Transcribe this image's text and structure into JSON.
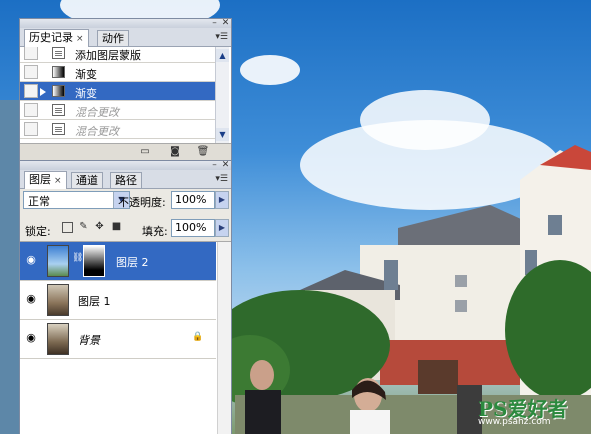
{
  "history_panel": {
    "tabs": [
      {
        "label": "历史记录",
        "close": "×"
      },
      {
        "label": "动作"
      }
    ],
    "menu_icon": "▾☰",
    "items": [
      {
        "label": "添加图层蒙版",
        "icon": "document-icon",
        "state": "normal"
      },
      {
        "label": "渐变",
        "icon": "gradient-icon",
        "state": "normal"
      },
      {
        "label": "渐变",
        "icon": "gradient-icon",
        "state": "selected"
      },
      {
        "label": "混合更改",
        "icon": "document-icon",
        "state": "greyed"
      },
      {
        "label": "混合更改",
        "icon": "document-icon",
        "state": "greyed"
      }
    ],
    "bottom_buttons": [
      "new-document-from-state-icon",
      "new-snapshot-icon",
      "trash-icon"
    ]
  },
  "layers_panel": {
    "tabs": [
      {
        "label": "图层",
        "close": "×"
      },
      {
        "label": "通道"
      },
      {
        "label": "路径"
      }
    ],
    "blend_mode": "正常",
    "opacity_label": "不透明度:",
    "opacity_value": "100%",
    "lock_label": "锁定:",
    "lock_icons": [
      "lock-transparent-icon",
      "lock-image-icon",
      "lock-position-icon",
      "lock-all-icon"
    ],
    "fill_label": "填充:",
    "fill_value": "100%",
    "layers": [
      {
        "name": "图层 2",
        "selected": true,
        "has_mask": true,
        "visible": true
      },
      {
        "name": "图层 1",
        "selected": false,
        "has_mask": false,
        "visible": true
      },
      {
        "name": "背景",
        "selected": false,
        "has_mask": false,
        "visible": true,
        "locked": true
      }
    ]
  },
  "watermark": {
    "text": "PS爱好者",
    "url": "www.psahz.com"
  },
  "colors": {
    "selection": "#3369c2",
    "panel_bg": "#ebe9e3"
  }
}
